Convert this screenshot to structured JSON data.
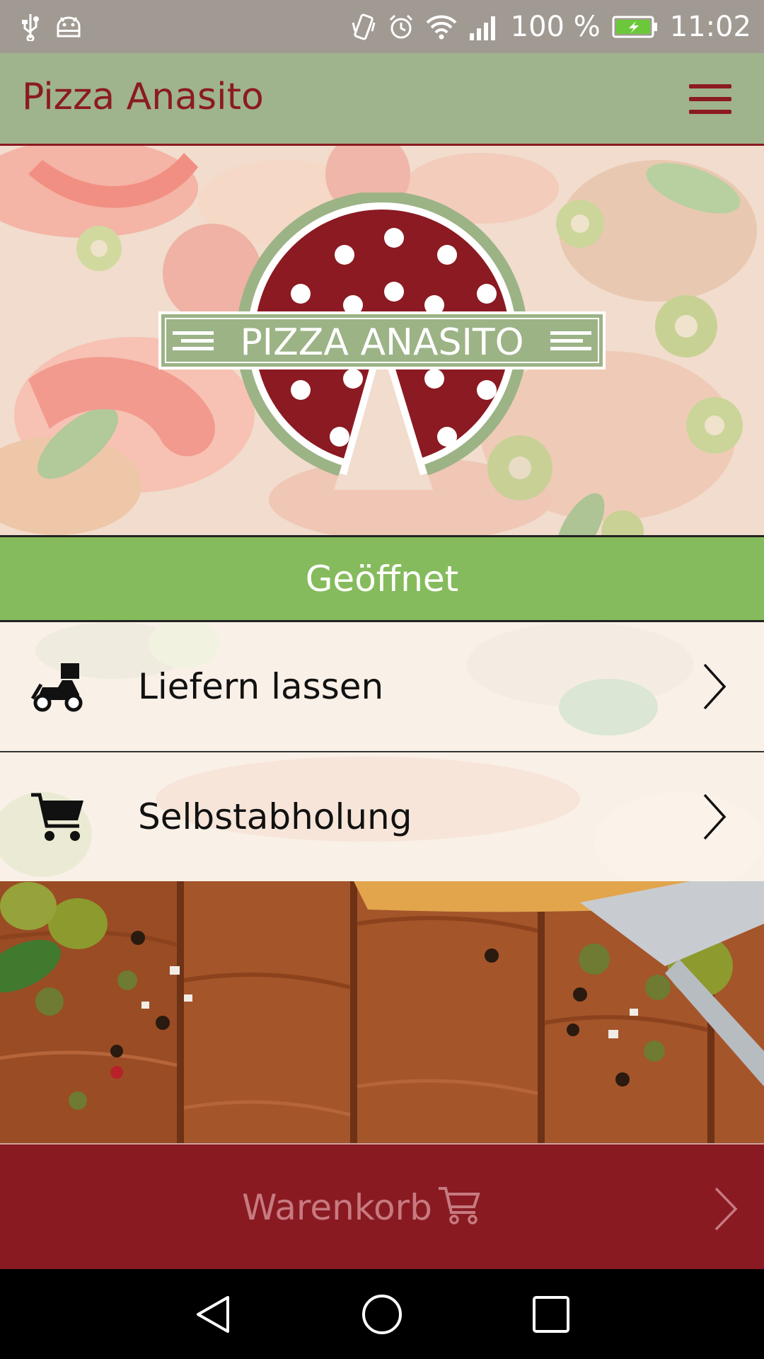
{
  "status_bar": {
    "battery": "100 %",
    "time": "11:02"
  },
  "app_bar": {
    "title": "Pizza Anasito"
  },
  "logo": {
    "text": "PIZZA ANASITO"
  },
  "open_status": "Geöffnet",
  "options": [
    {
      "label": "Liefern lassen",
      "icon": "delivery-scooter-icon"
    },
    {
      "label": "Selbstabholung",
      "icon": "shopping-cart-icon"
    }
  ],
  "cart": {
    "label": "Warenkorb"
  },
  "colors": {
    "brand_red": "#8b1a22",
    "brand_green": "#9fb38d",
    "open_green": "#85bb5c",
    "cart_text": "#c77a80"
  }
}
